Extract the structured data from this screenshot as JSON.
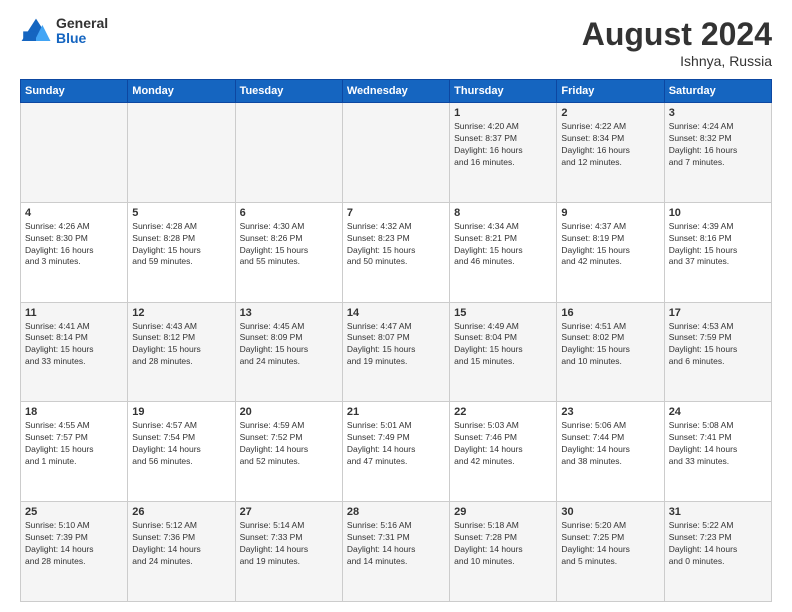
{
  "header": {
    "logo": {
      "general": "General",
      "blue": "Blue"
    },
    "month_year": "August 2024",
    "location": "Ishnya, Russia"
  },
  "days_of_week": [
    "Sunday",
    "Monday",
    "Tuesday",
    "Wednesday",
    "Thursday",
    "Friday",
    "Saturday"
  ],
  "weeks": [
    [
      {
        "date": "",
        "info": ""
      },
      {
        "date": "",
        "info": ""
      },
      {
        "date": "",
        "info": ""
      },
      {
        "date": "",
        "info": ""
      },
      {
        "date": "1",
        "info": "Sunrise: 4:20 AM\nSunset: 8:37 PM\nDaylight: 16 hours\nand 16 minutes."
      },
      {
        "date": "2",
        "info": "Sunrise: 4:22 AM\nSunset: 8:34 PM\nDaylight: 16 hours\nand 12 minutes."
      },
      {
        "date": "3",
        "info": "Sunrise: 4:24 AM\nSunset: 8:32 PM\nDaylight: 16 hours\nand 7 minutes."
      }
    ],
    [
      {
        "date": "4",
        "info": "Sunrise: 4:26 AM\nSunset: 8:30 PM\nDaylight: 16 hours\nand 3 minutes."
      },
      {
        "date": "5",
        "info": "Sunrise: 4:28 AM\nSunset: 8:28 PM\nDaylight: 15 hours\nand 59 minutes."
      },
      {
        "date": "6",
        "info": "Sunrise: 4:30 AM\nSunset: 8:26 PM\nDaylight: 15 hours\nand 55 minutes."
      },
      {
        "date": "7",
        "info": "Sunrise: 4:32 AM\nSunset: 8:23 PM\nDaylight: 15 hours\nand 50 minutes."
      },
      {
        "date": "8",
        "info": "Sunrise: 4:34 AM\nSunset: 8:21 PM\nDaylight: 15 hours\nand 46 minutes."
      },
      {
        "date": "9",
        "info": "Sunrise: 4:37 AM\nSunset: 8:19 PM\nDaylight: 15 hours\nand 42 minutes."
      },
      {
        "date": "10",
        "info": "Sunrise: 4:39 AM\nSunset: 8:16 PM\nDaylight: 15 hours\nand 37 minutes."
      }
    ],
    [
      {
        "date": "11",
        "info": "Sunrise: 4:41 AM\nSunset: 8:14 PM\nDaylight: 15 hours\nand 33 minutes."
      },
      {
        "date": "12",
        "info": "Sunrise: 4:43 AM\nSunset: 8:12 PM\nDaylight: 15 hours\nand 28 minutes."
      },
      {
        "date": "13",
        "info": "Sunrise: 4:45 AM\nSunset: 8:09 PM\nDaylight: 15 hours\nand 24 minutes."
      },
      {
        "date": "14",
        "info": "Sunrise: 4:47 AM\nSunset: 8:07 PM\nDaylight: 15 hours\nand 19 minutes."
      },
      {
        "date": "15",
        "info": "Sunrise: 4:49 AM\nSunset: 8:04 PM\nDaylight: 15 hours\nand 15 minutes."
      },
      {
        "date": "16",
        "info": "Sunrise: 4:51 AM\nSunset: 8:02 PM\nDaylight: 15 hours\nand 10 minutes."
      },
      {
        "date": "17",
        "info": "Sunrise: 4:53 AM\nSunset: 7:59 PM\nDaylight: 15 hours\nand 6 minutes."
      }
    ],
    [
      {
        "date": "18",
        "info": "Sunrise: 4:55 AM\nSunset: 7:57 PM\nDaylight: 15 hours\nand 1 minute."
      },
      {
        "date": "19",
        "info": "Sunrise: 4:57 AM\nSunset: 7:54 PM\nDaylight: 14 hours\nand 56 minutes."
      },
      {
        "date": "20",
        "info": "Sunrise: 4:59 AM\nSunset: 7:52 PM\nDaylight: 14 hours\nand 52 minutes."
      },
      {
        "date": "21",
        "info": "Sunrise: 5:01 AM\nSunset: 7:49 PM\nDaylight: 14 hours\nand 47 minutes."
      },
      {
        "date": "22",
        "info": "Sunrise: 5:03 AM\nSunset: 7:46 PM\nDaylight: 14 hours\nand 42 minutes."
      },
      {
        "date": "23",
        "info": "Sunrise: 5:06 AM\nSunset: 7:44 PM\nDaylight: 14 hours\nand 38 minutes."
      },
      {
        "date": "24",
        "info": "Sunrise: 5:08 AM\nSunset: 7:41 PM\nDaylight: 14 hours\nand 33 minutes."
      }
    ],
    [
      {
        "date": "25",
        "info": "Sunrise: 5:10 AM\nSunset: 7:39 PM\nDaylight: 14 hours\nand 28 minutes."
      },
      {
        "date": "26",
        "info": "Sunrise: 5:12 AM\nSunset: 7:36 PM\nDaylight: 14 hours\nand 24 minutes."
      },
      {
        "date": "27",
        "info": "Sunrise: 5:14 AM\nSunset: 7:33 PM\nDaylight: 14 hours\nand 19 minutes."
      },
      {
        "date": "28",
        "info": "Sunrise: 5:16 AM\nSunset: 7:31 PM\nDaylight: 14 hours\nand 14 minutes."
      },
      {
        "date": "29",
        "info": "Sunrise: 5:18 AM\nSunset: 7:28 PM\nDaylight: 14 hours\nand 10 minutes."
      },
      {
        "date": "30",
        "info": "Sunrise: 5:20 AM\nSunset: 7:25 PM\nDaylight: 14 hours\nand 5 minutes."
      },
      {
        "date": "31",
        "info": "Sunrise: 5:22 AM\nSunset: 7:23 PM\nDaylight: 14 hours\nand 0 minutes."
      }
    ]
  ]
}
